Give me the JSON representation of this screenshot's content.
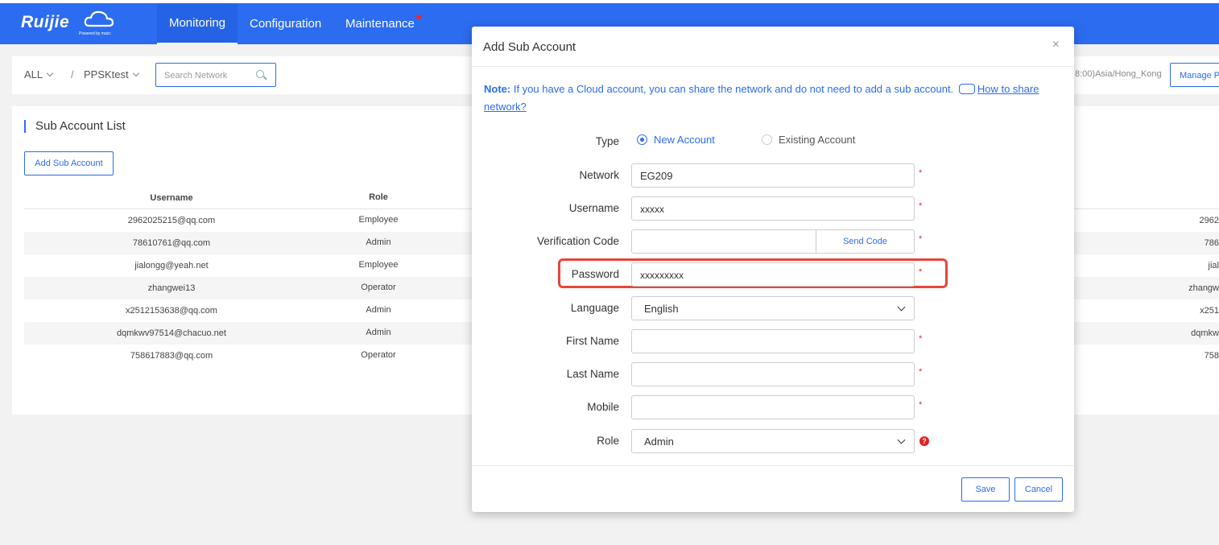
{
  "app": {
    "brand": "Ruijie",
    "brand_sub": "Powered by macc",
    "nav": [
      "Monitoring",
      "Configuration",
      "Maintenance"
    ]
  },
  "filter": {
    "scope": "ALL",
    "separator": "/",
    "network": "PPSKtest",
    "search_placeholder": "Search Network",
    "timezone": "8:00)Asia/Hong_Kong",
    "manage_label": "Manage P"
  },
  "panel": {
    "title": "Sub Account List",
    "add_label": "Add Sub Account",
    "columns": {
      "username": "Username",
      "role": "Role"
    },
    "rows": [
      {
        "username": "2962025215@qq.com",
        "role": "Employee",
        "right": "2962"
      },
      {
        "username": "78610761@qq.com",
        "role": "Admin",
        "right": "786"
      },
      {
        "username": "jialongg@yeah.net",
        "role": "Employee",
        "right": "jial"
      },
      {
        "username": "zhangwei13",
        "role": "Operator",
        "right": "zhangw"
      },
      {
        "username": "x2512153638@qq.com",
        "role": "Admin",
        "right": "x251"
      },
      {
        "username": "dqmkwv97514@chacuo.net",
        "role": "Admin",
        "right": "dqmkw"
      },
      {
        "username": "758617883@qq.com",
        "role": "Operator",
        "right": "758"
      }
    ]
  },
  "modal": {
    "title": "Add Sub Account",
    "close": "×",
    "note_bold": "Note:",
    "note_text": " If you have a Cloud account, you can share the network and do not need to add a sub account.",
    "note_link": "How to share network?",
    "type_label": "Type",
    "type_new": "New Account",
    "type_existing": "Existing Account",
    "network_label": "Network",
    "network_value": "EG209",
    "username_label": "Username",
    "username_value": "xxxxx",
    "verification_label": "Verification Code",
    "send_code": "Send Code",
    "password_label": "Password",
    "password_value": "xxxxxxxxx",
    "language_label": "Language",
    "language_value": "English",
    "firstname_label": "First Name",
    "lastname_label": "Last Name",
    "mobile_label": "Mobile",
    "role_label": "Role",
    "role_value": "Admin",
    "required": "*",
    "help": "?",
    "save": "Save",
    "cancel": "Cancel"
  }
}
